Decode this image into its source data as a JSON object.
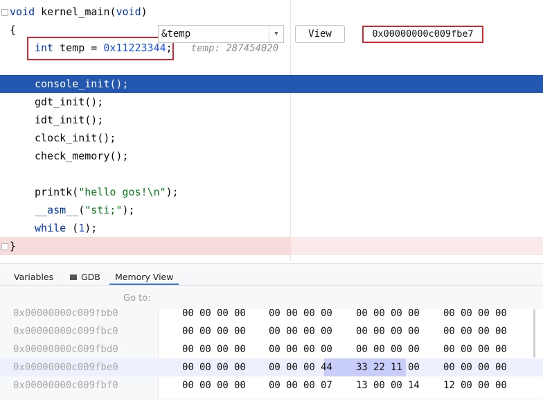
{
  "editor": {
    "lines": [
      {
        "text": "void kernel_main(void)"
      },
      {
        "text": "{"
      },
      {
        "kw": "int",
        "var": " temp = ",
        "num": "0x11223344",
        "tail": ";",
        "hint": "temp: 287454020"
      },
      {
        "text": ""
      },
      {
        "text": "console_init();"
      },
      {
        "text": "gdt_init();"
      },
      {
        "text": "idt_init();"
      },
      {
        "text": "clock_init();"
      },
      {
        "text": "check_memory();"
      },
      {
        "text": ""
      },
      {
        "pre": "printk(",
        "str": "\"hello gos!\\n\"",
        "post": ");"
      },
      {
        "asm_kw": "__asm__",
        "pre2": "(",
        "str2": "\"sti;\"",
        "post2": ");"
      },
      {
        "kw2": "while",
        "pre3": " (",
        "num3": "1",
        "post3": ");"
      },
      {
        "text": "}"
      }
    ]
  },
  "panel": {
    "tabs": [
      "Variables",
      "GDB",
      "Memory View"
    ],
    "goto_label": "Go to:",
    "goto_value": "&temp",
    "view_label": "View",
    "address_display": "0x00000000c009fbe7"
  },
  "memory": {
    "rows": [
      {
        "addr": "0x00000000c009fbb0",
        "bytes": [
          "00",
          "00",
          "00",
          "00",
          "00",
          "00",
          "00",
          "00",
          "00",
          "00",
          "00",
          "00",
          "00",
          "00",
          "00",
          "00"
        ]
      },
      {
        "addr": "0x00000000c009fbc0",
        "bytes": [
          "00",
          "00",
          "00",
          "00",
          "00",
          "00",
          "00",
          "00",
          "00",
          "00",
          "00",
          "00",
          "00",
          "00",
          "00",
          "00"
        ]
      },
      {
        "addr": "0x00000000c009fbd0",
        "bytes": [
          "00",
          "00",
          "00",
          "00",
          "00",
          "00",
          "00",
          "00",
          "00",
          "00",
          "00",
          "00",
          "00",
          "00",
          "00",
          "00"
        ]
      },
      {
        "addr": "0x00000000c009fbe0",
        "bytes": [
          "00",
          "00",
          "00",
          "00",
          "00",
          "00",
          "00",
          "44",
          "33",
          "22",
          "11",
          "00",
          "00",
          "00",
          "00",
          "00"
        ]
      },
      {
        "addr": "0x00000000c009fbf0",
        "bytes": [
          "00",
          "00",
          "00",
          "00",
          "00",
          "00",
          "00",
          "07",
          "13",
          "00",
          "00",
          "14",
          "12",
          "00",
          "00",
          "00"
        ]
      }
    ]
  }
}
